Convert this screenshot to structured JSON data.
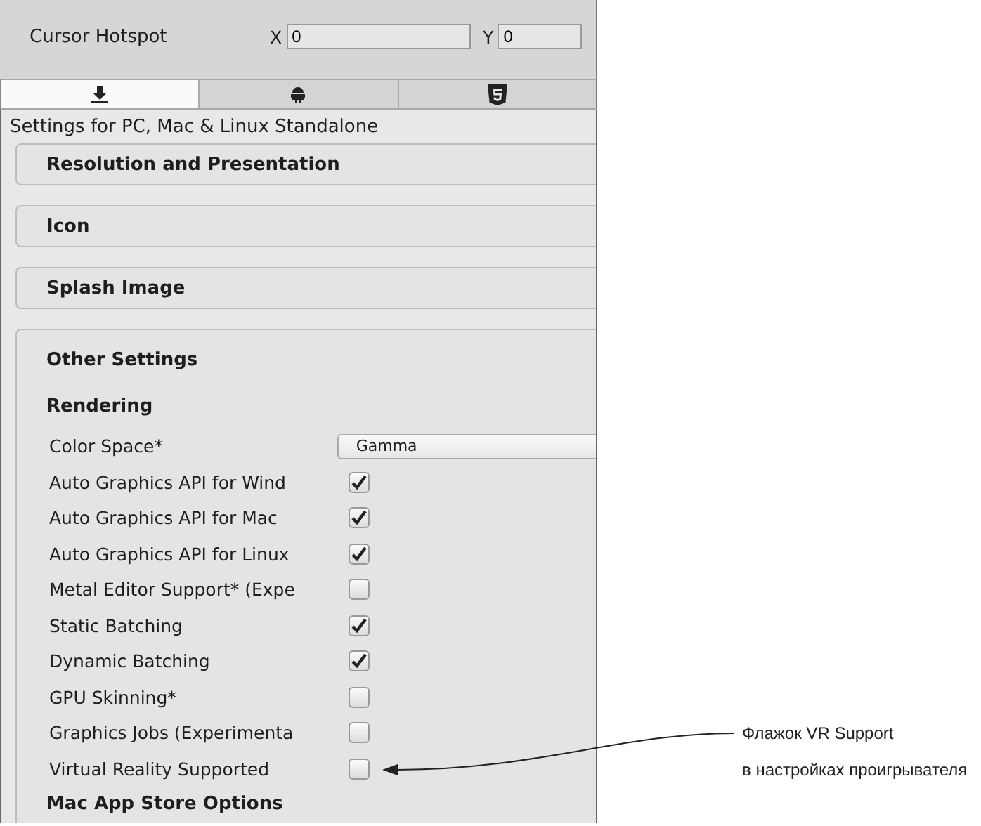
{
  "cursor_hotspot": {
    "label": "Cursor Hotspot",
    "x_label": "X",
    "x_value": "0",
    "y_label": "Y",
    "y_value": "0"
  },
  "platform_tabs": [
    {
      "kind": "download",
      "selected": true
    },
    {
      "kind": "android",
      "selected": false
    },
    {
      "kind": "html5",
      "selected": false
    }
  ],
  "settings_title": "Settings for PC, Mac & Linux Standalone",
  "sections": [
    {
      "title": "Resolution and Presentation",
      "expanded": false
    },
    {
      "title": "Icon",
      "expanded": false
    },
    {
      "title": "Splash Image",
      "expanded": false
    },
    {
      "title": "Other Settings",
      "expanded": true,
      "groups": [
        {
          "title": "Rendering",
          "rows": [
            {
              "kind": "dropdown",
              "label": "Color Space*",
              "value": "Gamma"
            },
            {
              "kind": "checkbox",
              "label": "Auto Graphics API for Wind",
              "checked": true
            },
            {
              "kind": "checkbox",
              "label": "Auto Graphics API for Mac",
              "checked": true
            },
            {
              "kind": "checkbox",
              "label": "Auto Graphics API for Linux",
              "checked": true
            },
            {
              "kind": "checkbox",
              "label": "Metal Editor Support* (Expe",
              "checked": false
            },
            {
              "kind": "checkbox",
              "label": "Static Batching",
              "checked": true
            },
            {
              "kind": "checkbox",
              "label": "Dynamic Batching",
              "checked": true
            },
            {
              "kind": "checkbox",
              "label": "GPU Skinning*",
              "checked": false
            },
            {
              "kind": "checkbox",
              "label": "Graphics Jobs (Experimenta",
              "checked": false
            },
            {
              "kind": "checkbox",
              "label": "Virtual Reality Supported",
              "checked": false
            }
          ]
        },
        {
          "title": "Mac App Store Options"
        }
      ]
    }
  ],
  "annotation": {
    "text": "Флажок VR Support\nв настройках проигрывателя"
  }
}
